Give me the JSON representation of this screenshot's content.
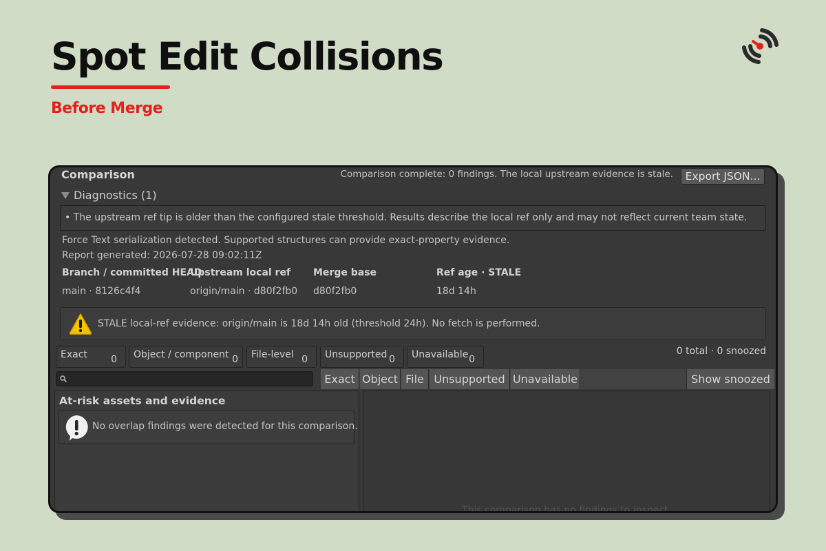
{
  "hero": {
    "title": "Spot Edit Collisions",
    "subtitle": "Before Merge"
  },
  "colors": {
    "accent": "#e3211b",
    "background": "#d0dcc6",
    "panel": "#383838"
  },
  "comparison": {
    "title": "Comparison",
    "status": "Comparison complete: 0 findings. The local upstream evidence is stale.",
    "export_label": "Export JSON..."
  },
  "diagnostics": {
    "toggle_label": "Diagnostics (1)",
    "message": "• The upstream ref tip is older than the configured stale threshold. Results describe the local ref only and may not reflect current team state."
  },
  "meta": {
    "serialization": "Force Text serialization detected. Supported structures can provide exact-property evidence.",
    "report_generated": "Report generated: 2026-07-28 09:02:11Z"
  },
  "refs": {
    "headers": [
      "Branch / committed HEAD",
      "Upstream local ref",
      "Merge base",
      "Ref age · STALE"
    ],
    "values": [
      "main · 8126c4f4",
      "origin/main · d80f2fb0",
      "d80f2fb0",
      "18d 14h"
    ]
  },
  "warning": {
    "icon": "warning-icon",
    "text": "STALE local-ref evidence: origin/main is 18d 14h old (threshold 24h). No fetch is performed."
  },
  "filters": [
    {
      "label": "Exact",
      "count": "0"
    },
    {
      "label": "Object / component",
      "count": "0"
    },
    {
      "label": "File-level",
      "count": "0"
    },
    {
      "label": "Unsupported",
      "count": "0"
    },
    {
      "label": "Unavailable",
      "count": "0"
    }
  ],
  "totals": "0 total · 0 snoozed",
  "search": {
    "placeholder": ""
  },
  "tabs": [
    "Exact",
    "Object",
    "File",
    "Unsupported",
    "Unavailable"
  ],
  "show_snoozed_label": "Show snoozed",
  "left_pane": {
    "title": "At-risk assets and evidence",
    "info_icon": "exclamation-bubble-icon",
    "info_text": "No overlap findings were detected for this comparison."
  },
  "right_pane": {
    "empty_text": "This comparison has no findings to inspect."
  }
}
